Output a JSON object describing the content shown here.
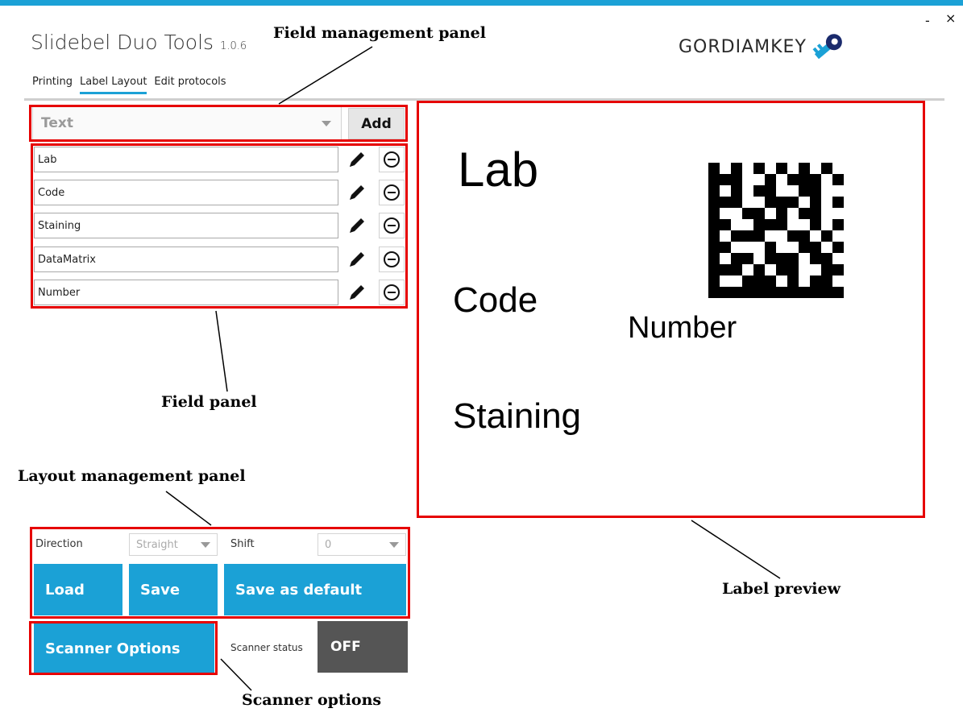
{
  "window": {
    "minimize_glyph": "-",
    "close_glyph": "×"
  },
  "app": {
    "title": "Slidebel Duo Tools",
    "version": "1.0.6",
    "logo_text": "GORDIAMKEY",
    "accent_color": "#1ba1d6"
  },
  "tabs": [
    {
      "label": "Printing"
    },
    {
      "label": "Label Layout",
      "active": true
    },
    {
      "label": "Edit protocols"
    }
  ],
  "field_management": {
    "type_combo_value": "Text",
    "add_label": "Add"
  },
  "fields": [
    {
      "name": "Lab"
    },
    {
      "name": "Code"
    },
    {
      "name": "Staining"
    },
    {
      "name": "DataMatrix"
    },
    {
      "name": "Number"
    }
  ],
  "preview": {
    "lab": "Lab",
    "code": "Code",
    "number": "Number",
    "staining": "Staining"
  },
  "layout_management": {
    "direction_label": "Direction",
    "direction_value": "Straight",
    "shift_label": "Shift",
    "shift_value": "0",
    "load_label": "Load",
    "save_label": "Save",
    "save_default_label": "Save as default"
  },
  "scanner": {
    "options_label": "Scanner Options",
    "status_label": "Scanner status",
    "status_value": "OFF"
  },
  "callouts": {
    "field_management_panel": "Field management panel",
    "field_panel": "Field panel",
    "layout_management_panel": "Layout management panel",
    "label_preview": "Label preview",
    "scanner_options": "Scanner options"
  },
  "annotation_color": "#e60000"
}
